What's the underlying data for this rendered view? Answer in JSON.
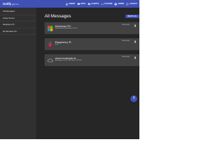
{
  "app": {
    "name": "Gotify",
    "version": "@2.1.0"
  },
  "nav": {
    "items": [
      {
        "label": "USERS",
        "icon": "people-icon"
      },
      {
        "label": "APPS",
        "icon": "chat-icon"
      },
      {
        "label": "CLIENTS",
        "icon": "devices-icon"
      },
      {
        "label": "PLUGINS",
        "icon": "code-icon"
      },
      {
        "label": "ADMIN",
        "icon": "account-icon"
      },
      {
        "label": "LOGOUT",
        "icon": "exit-icon"
      }
    ]
  },
  "sidebar": {
    "items": [
      {
        "label": "All Messages"
      },
      {
        "label": "Gotify Server"
      },
      {
        "label": "Raspberry Pi"
      },
      {
        "label": "Mi Windows PC"
      }
    ]
  },
  "main": {
    "title": "All Messages",
    "delete_all_label": "DELETE ALL",
    "messages": [
      {
        "title": "Windows PC",
        "message": "Windowsmessy-Windows 10 Pro",
        "time": "2 days ago",
        "avatar": "windows-logo-icon"
      },
      {
        "title": "Raspberry Pi",
        "message": "Stats",
        "time": "2 days ago",
        "avatar": "raspberry-logo-icon"
      },
      {
        "title": "cloud.example.io",
        "message": "Message for user \"cert\" from 17.78.52.1",
        "time": "2 days ago",
        "avatar": "cloud-icon"
      }
    ]
  },
  "fab": {
    "icon": "arrow-up-icon",
    "glyph": "↑"
  },
  "colors": {
    "primary": "#3f51b5",
    "background": "#262626",
    "card": "#424242",
    "sidebar": "#303030"
  }
}
